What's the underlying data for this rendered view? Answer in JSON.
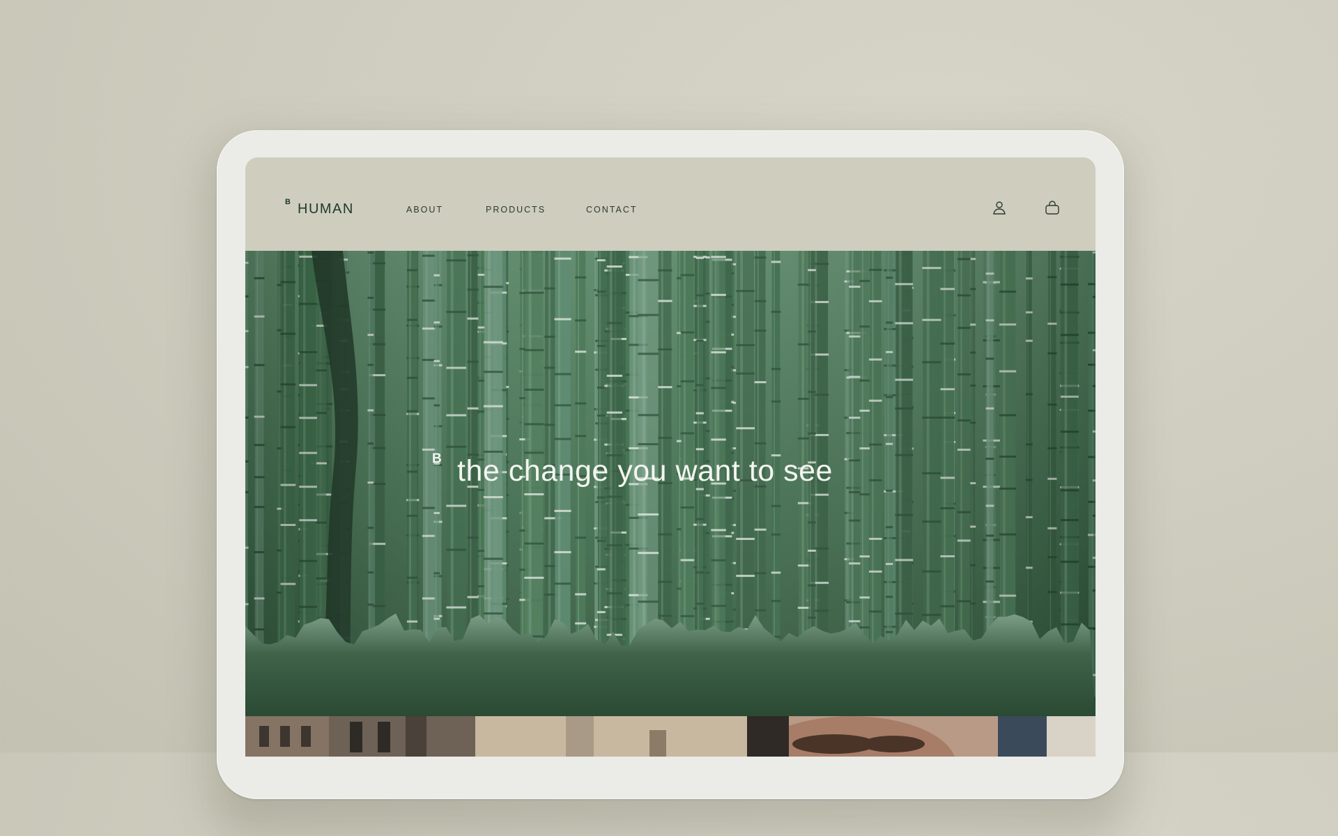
{
  "brand": {
    "mark": "B",
    "name": "HUMAN"
  },
  "nav": {
    "links": [
      "ABOUT",
      "PRODUCTS",
      "CONTACT"
    ],
    "icons": [
      "user-icon",
      "bag-icon"
    ]
  },
  "hero": {
    "mark": "B",
    "tagline": "the change you want to see"
  },
  "colors": {
    "background": "#cfcdbf",
    "nav_bg": "#cfcdbd",
    "brand_green": "#1d3a2a",
    "hero_green": "#3e6a4c",
    "tagline_text": "#f3f5f0"
  }
}
